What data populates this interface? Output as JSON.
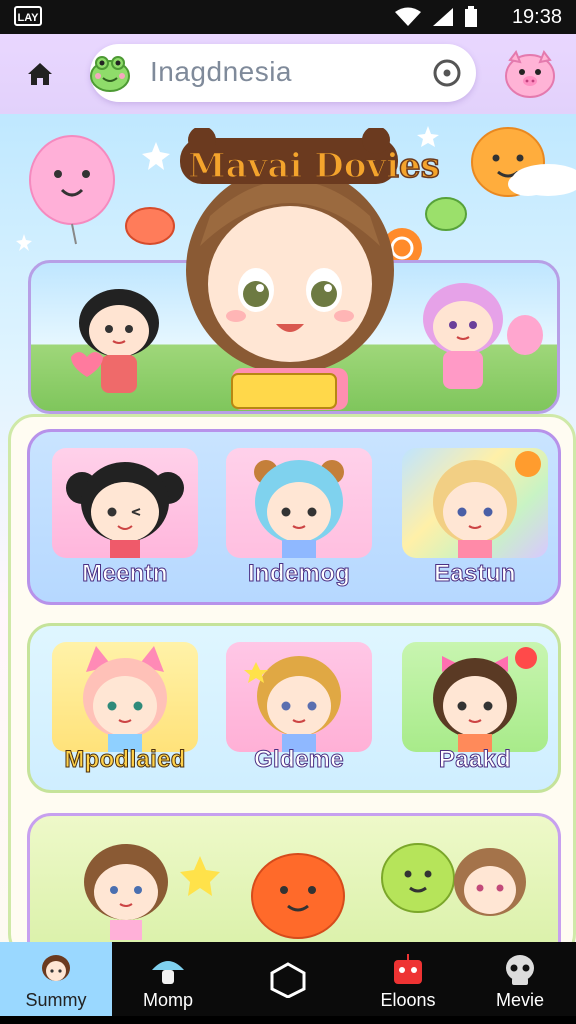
{
  "status_bar": {
    "time": "19:38",
    "logo": "LAY"
  },
  "app_bar": {
    "search_value": "Inagdnesia"
  },
  "banner": {
    "title": "Mavai Dovies"
  },
  "characters": [
    {
      "label": "Meentn"
    },
    {
      "label": "Indemog"
    },
    {
      "label": "Eastun"
    },
    {
      "label": "Mpodlaied"
    },
    {
      "label": "Gldeme"
    },
    {
      "label": "Paakd"
    }
  ],
  "bottom_nav": [
    {
      "label": "Summy",
      "icon": "girl-avatar-icon",
      "active": true
    },
    {
      "label": "Momp",
      "icon": "mushroom-icon",
      "active": false
    },
    {
      "label": "",
      "icon": "hexagon-icon",
      "active": false
    },
    {
      "label": "Eloons",
      "icon": "robot-icon",
      "active": false
    },
    {
      "label": "Mevie",
      "icon": "skull-icon",
      "active": false
    }
  ],
  "colors": {
    "app_bar_bg": "#e9d7ff",
    "accent_purple": "#b792ea",
    "active_tab": "#9ad8ff",
    "nav_bg": "#0b0b0b"
  }
}
